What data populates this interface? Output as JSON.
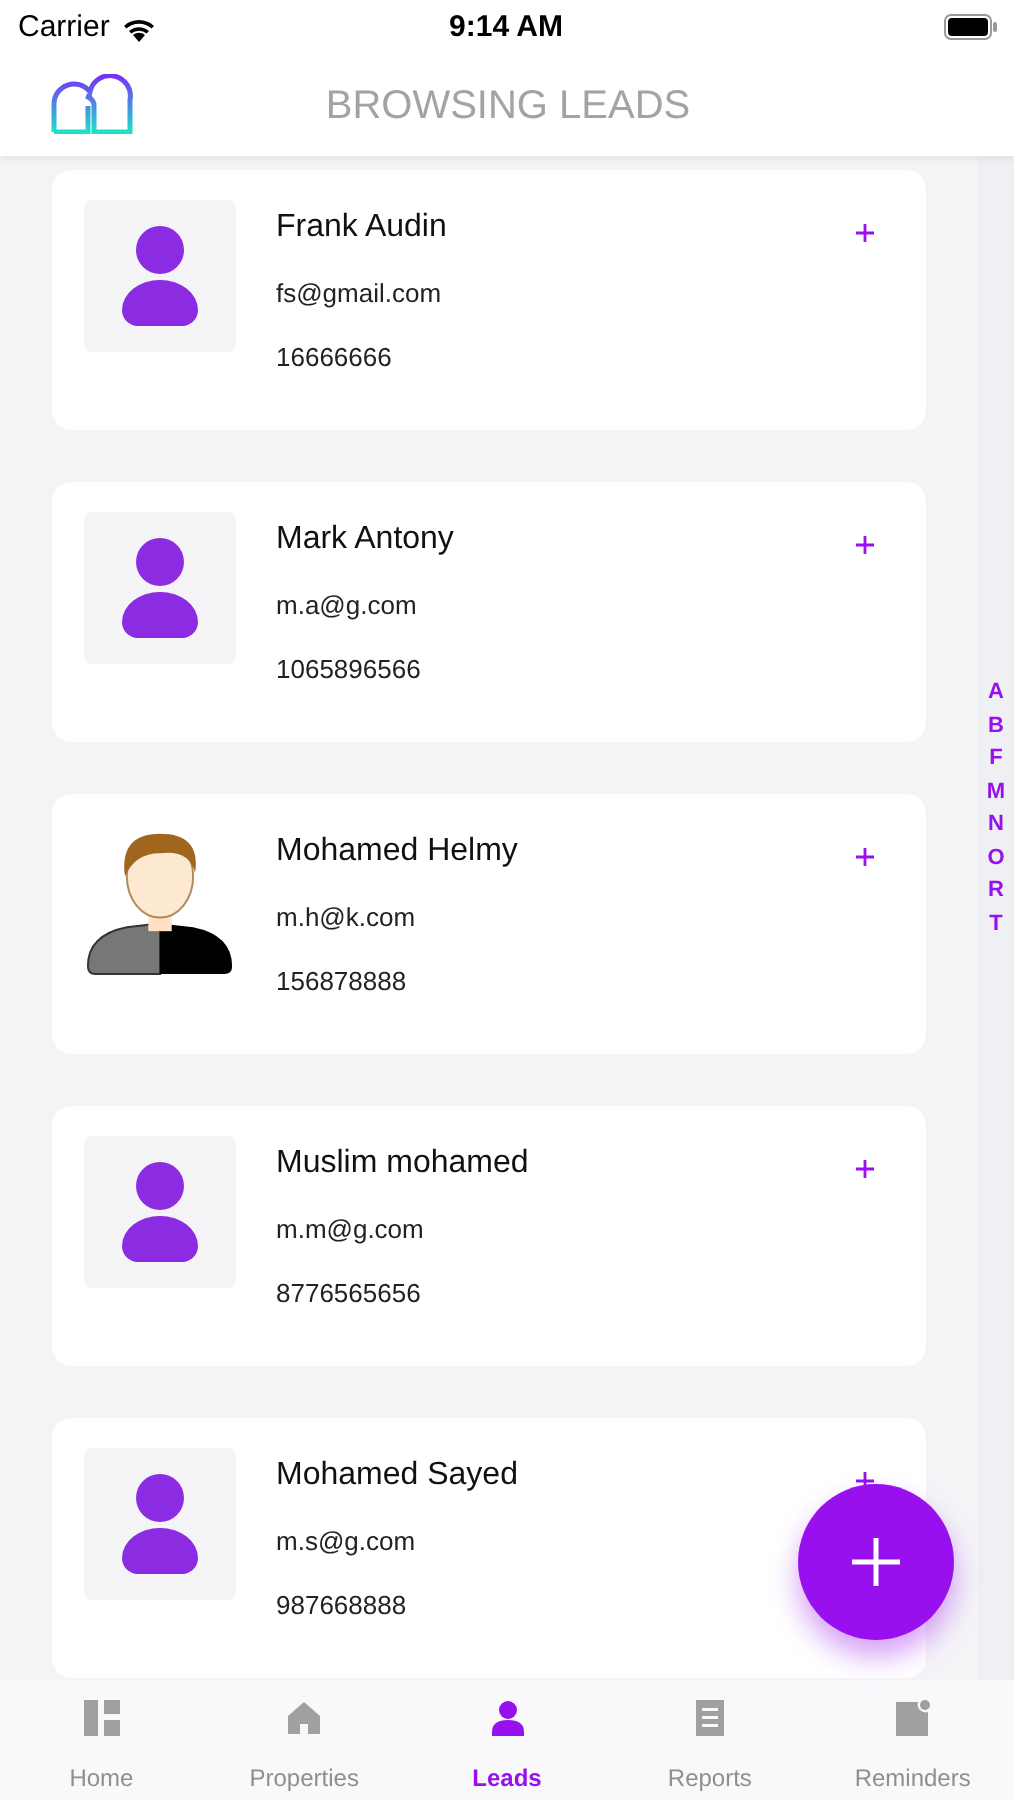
{
  "status_bar": {
    "carrier": "Carrier",
    "time": "9:14 AM"
  },
  "header": {
    "title": "BROWSING LEADS"
  },
  "leads": [
    {
      "name": "Frank Audin",
      "email": "fs@gmail.com",
      "phone": "16666666",
      "kind": "placeholder"
    },
    {
      "name": "Mark Antony",
      "email": "m.a@g.com",
      "phone": "1065896566",
      "kind": "placeholder"
    },
    {
      "name": "Mohamed Helmy",
      "email": "m.h@k.com",
      "phone": "156878888",
      "kind": "illustration"
    },
    {
      "name": "Muslim mohamed",
      "email": "m.m@g.com",
      "phone": "8776565656",
      "kind": "placeholder"
    },
    {
      "name": "Mohamed Sayed",
      "email": "m.s@g.com",
      "phone": "987668888",
      "kind": "placeholder"
    }
  ],
  "index_letters": [
    "A",
    "B",
    "F",
    "M",
    "N",
    "O",
    "R",
    "T"
  ],
  "tabs": [
    {
      "label": "Home",
      "kind": "home",
      "selected": false
    },
    {
      "label": "Properties",
      "kind": "properties",
      "selected": false
    },
    {
      "label": "Leads",
      "kind": "leads",
      "selected": true
    },
    {
      "label": "Reports",
      "kind": "reports",
      "selected": false
    },
    {
      "label": "Reminders",
      "kind": "reminders",
      "selected": false
    }
  ]
}
